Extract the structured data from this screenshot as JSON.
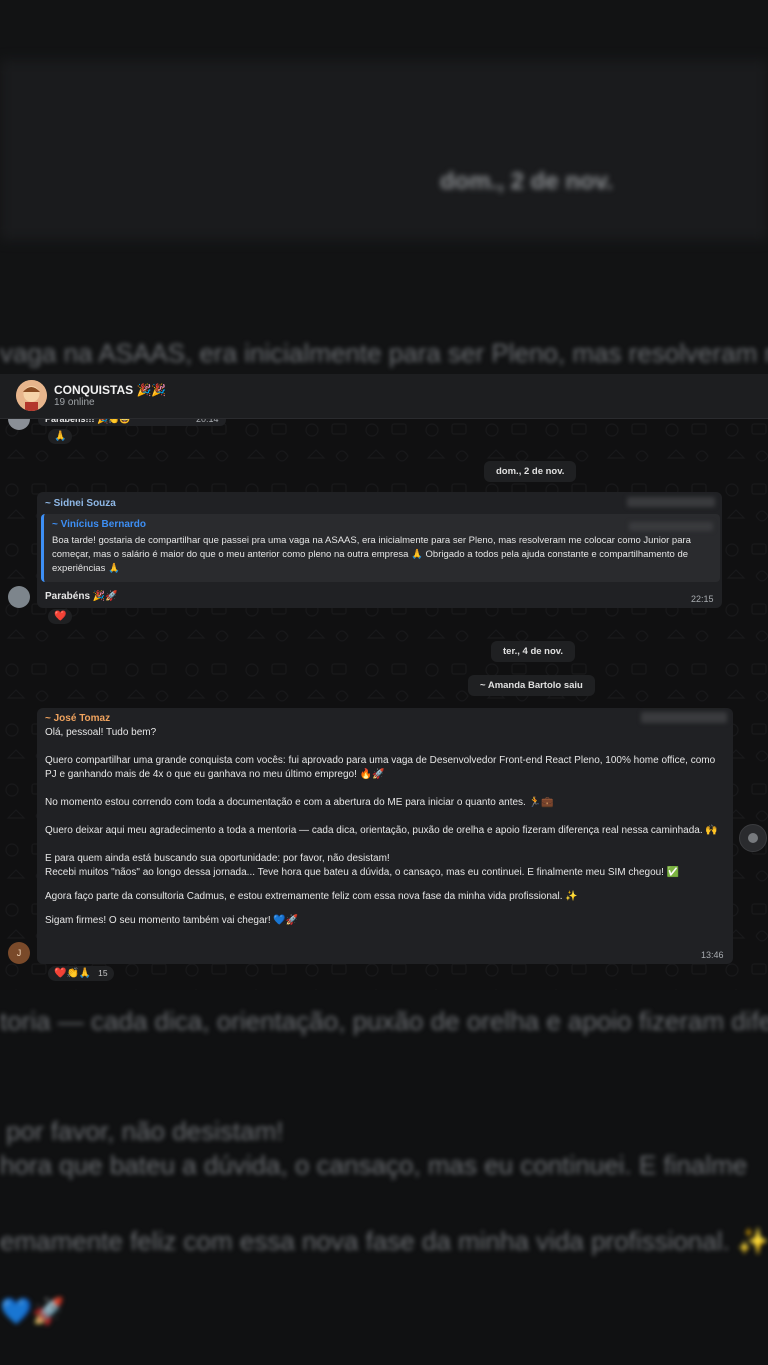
{
  "background": {
    "top_date": "dom., 2 de nov.",
    "top_fragment": "vaga na ASAAS, era inicialmente para ser Pleno, mas resolveram me",
    "bottom_line1": "toria — cada dica, orientação, puxão de orelha e apoio fizeram dife",
    "bottom_line2": "por favor, não desistam!",
    "bottom_line3": "hora que bateu a dúvida, o cansaço, mas eu continuei. E finalme",
    "bottom_line4": "emamente feliz com essa nova fase da minha vida profissional. ✨",
    "bottom_line5": "💙🚀"
  },
  "header": {
    "title": "CONQUISTAS 🎉🎉",
    "subtitle": "19 online"
  },
  "prev_message": {
    "text": "Parabéns!!! 🎉👏😄",
    "time": "20:14",
    "reaction": "🙏"
  },
  "date_sep_1": "dom., 2 de nov.",
  "msg_sidnei": {
    "sender": "~ Sidnei Souza",
    "quote_sender": "~ Vinícius Bernardo",
    "quote_text": "Boa tarde! gostaria de compartilhar que passei pra uma vaga na ASAAS, era inicialmente para ser Pleno, mas resolveram me colocar como Junior para começar, mas o salário é maior do que o meu anterior como pleno na outra empresa 🙏 Obrigado a todos pela ajuda constante e compartilhamento de experiências 🙏",
    "text": "Parabéns 🎉🚀",
    "time": "22:15",
    "reaction": "❤️"
  },
  "date_sep_2": "ter., 4 de nov.",
  "system_left": "~ Amanda Bartolo saiu",
  "msg_jose": {
    "sender": "~ José Tomaz",
    "line1": "Olá, pessoal! Tudo bem?",
    "para1": "Quero compartilhar uma grande conquista com vocês: fui aprovado para uma vaga de Desenvolvedor Front-end React Pleno, 100% home office, como PJ e ganhando mais de 4x o que eu ganhava no meu último emprego! 🔥🚀",
    "para2": "No momento estou correndo com toda a documentação e com a abertura do ME para iniciar o quanto antes. 🏃💼",
    "para3": "Quero deixar aqui meu agradecimento a toda a mentoria — cada dica, orientação, puxão de orelha e apoio fizeram diferença real nessa caminhada. 🙌",
    "para4a": "E para quem ainda está buscando sua oportunidade: por favor, não desistam!",
    "para4b": "Recebi muitos \"nãos\" ao longo dessa jornada... Teve hora que bateu a dúvida, o cansaço, mas eu continuei. E finalmente meu SIM chegou! ✅",
    "para5": "Agora faço parte da consultoria Cadmus, e estou extremamente feliz com essa nova fase da minha vida profissional. ✨",
    "para6": "Sigam firmes! O seu momento também vai chegar! 💙🚀",
    "time": "13:46",
    "avatar_letter": "J",
    "reactions": "❤️👏🙏",
    "reaction_count": "15"
  },
  "colors": {
    "sidnei": "#8fb8e6",
    "vinicius": "#3d8ff5",
    "jose": "#f0a35e"
  }
}
